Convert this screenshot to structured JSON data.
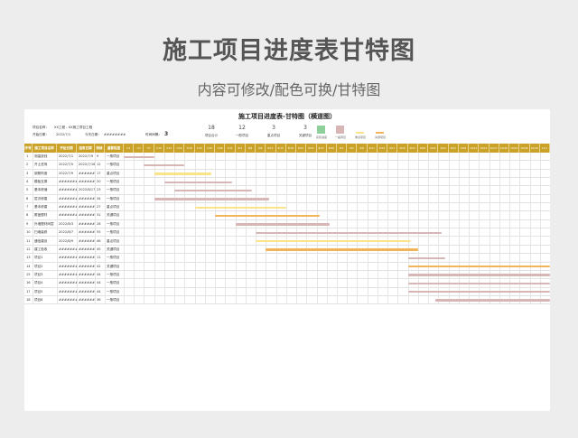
{
  "banner": {
    "title": "施工项目进度表甘特图",
    "subtitle": "内容可修改/配色可换/甘特图"
  },
  "sheet": {
    "title": "施工项目进度表-甘特图（横道图）",
    "project_name_label": "项目名称：",
    "project_name": "XX工程 - XX施工项目工程",
    "start_date_label": "开始日期：",
    "start_date": "2022/7/1",
    "today_label": "今天日期：",
    "today": "########",
    "interval_label": "时间间隔：",
    "interval": "3"
  },
  "summary": [
    {
      "value": "18",
      "label": "项目合计"
    },
    {
      "value": "12",
      "label": "一般项目"
    },
    {
      "value": "3",
      "label": "重点项目"
    },
    {
      "value": "3",
      "label": "关键项目"
    }
  ],
  "legend": [
    {
      "label": "实际进度",
      "color": "#8fcf9a"
    },
    {
      "label": "一般项目",
      "color": "#d8b6b6"
    },
    {
      "label": "重点项目",
      "color": "#fbe38a"
    },
    {
      "label": "关键项目",
      "color": "#f2b45a"
    }
  ],
  "columns": [
    "序号",
    "施工项目名称",
    "开始日期",
    "结束日期",
    "持续天数",
    "重要程度"
  ],
  "dates": [
    "7/1",
    "7/4",
    "7/7",
    "7/10",
    "7/13",
    "7/16",
    "7/19",
    "7/22",
    "7/25",
    "7/28",
    "7/31",
    "8/3",
    "8/6",
    "8/9",
    "8/12",
    "8/15",
    "8/18",
    "8/21",
    "8/24",
    "8/27",
    "8/30",
    "9/2",
    "9/5",
    "9/8",
    "9/11",
    "9/14",
    "9/17",
    "9/20",
    "9/23",
    "9/26",
    "9/29",
    "10/2",
    "10/5",
    "10/8",
    "10/11",
    "10/14",
    "10/17",
    "10/20",
    "10/23",
    "10/26",
    "10/29",
    "11/1"
  ],
  "colors": {
    "header": "#c9a227",
    "normal": "#d8b6b6",
    "key": "#fbe38a",
    "critical": "#f2b45a"
  },
  "rows": [
    {
      "no": "1",
      "name": "测量放线",
      "start": "2022/7/1",
      "end": "2022/7/9",
      "days": "9",
      "level": "一般项目",
      "type": "normal",
      "s": 0,
      "d": 9
    },
    {
      "no": "2",
      "name": "开土进场",
      "start": "2022/7/5",
      "end": "2022/7/16",
      "days": "12",
      "level": "一般项目",
      "type": "normal",
      "s": 6,
      "d": 12
    },
    {
      "no": "3",
      "name": "钢筋构造",
      "start": "2022/7/9",
      "end": "########",
      "days": "17",
      "level": "重点项目",
      "type": "key",
      "s": 9,
      "d": 17
    },
    {
      "no": "4",
      "name": "模板支撑",
      "start": "########",
      "end": "########",
      "days": "20",
      "level": "一般项目",
      "type": "normal",
      "s": 12,
      "d": 20
    },
    {
      "no": "5",
      "name": "基本修缮",
      "start": "########",
      "end": "2022/8/17",
      "days": "23",
      "level": "一般项目",
      "type": "normal",
      "s": 15,
      "d": 23
    },
    {
      "no": "6",
      "name": "层次修建",
      "start": "########",
      "end": "########",
      "days": "34",
      "level": "一般项目",
      "type": "normal",
      "s": 9,
      "d": 34
    },
    {
      "no": "7",
      "name": "基本修建",
      "start": "########",
      "end": "########",
      "days": "27",
      "level": "重点项目",
      "type": "key",
      "s": 21,
      "d": 27
    },
    {
      "no": "8",
      "name": "覆盖塑材",
      "start": "########",
      "end": "########",
      "days": "31",
      "level": "关键项目",
      "type": "critical",
      "s": 27,
      "d": 31
    },
    {
      "no": "9",
      "name": "外墙塑材间层",
      "start": "2022/8/3",
      "end": "########",
      "days": "28",
      "level": "一般项目",
      "type": "normal",
      "s": 33,
      "d": 28
    },
    {
      "no": "10",
      "name": "扫墙装修",
      "start": "2022/8/7",
      "end": "########",
      "days": "55",
      "level": "一般项目",
      "type": "normal",
      "s": 39,
      "d": 55
    },
    {
      "no": "11",
      "name": "通信建设",
      "start": "2022/8/9",
      "end": "########",
      "days": "46",
      "level": "重点项目",
      "type": "key",
      "s": 39,
      "d": 46
    },
    {
      "no": "12",
      "name": "建工验收",
      "start": "########",
      "end": "########",
      "days": "45",
      "level": "关键项目",
      "type": "critical",
      "s": 42,
      "d": 45
    },
    {
      "no": "13",
      "name": "项目1",
      "start": "########",
      "end": "########",
      "days": "11",
      "level": "一般项目",
      "type": "normal",
      "s": 84,
      "d": 11
    },
    {
      "no": "14",
      "name": "项目2",
      "start": "########",
      "end": "########",
      "days": "42",
      "level": "关键项目",
      "type": "critical",
      "s": 84,
      "d": 42
    },
    {
      "no": "15",
      "name": "项目3",
      "start": "########",
      "end": "########",
      "days": "44",
      "level": "一般项目",
      "type": "normal",
      "s": 84,
      "d": 44
    },
    {
      "no": "16",
      "name": "项目4",
      "start": "########",
      "end": "########",
      "days": "44",
      "level": "一般项目",
      "type": "normal",
      "s": 84,
      "d": 44
    },
    {
      "no": "17",
      "name": "项目5",
      "start": "########",
      "end": "########",
      "days": "44",
      "level": "一般项目",
      "type": "normal",
      "s": 84,
      "d": 44
    },
    {
      "no": "18",
      "name": "项目6",
      "start": "########",
      "end": "########",
      "days": "36",
      "level": "一般项目",
      "type": "normal",
      "s": 92,
      "d": 36
    }
  ]
}
